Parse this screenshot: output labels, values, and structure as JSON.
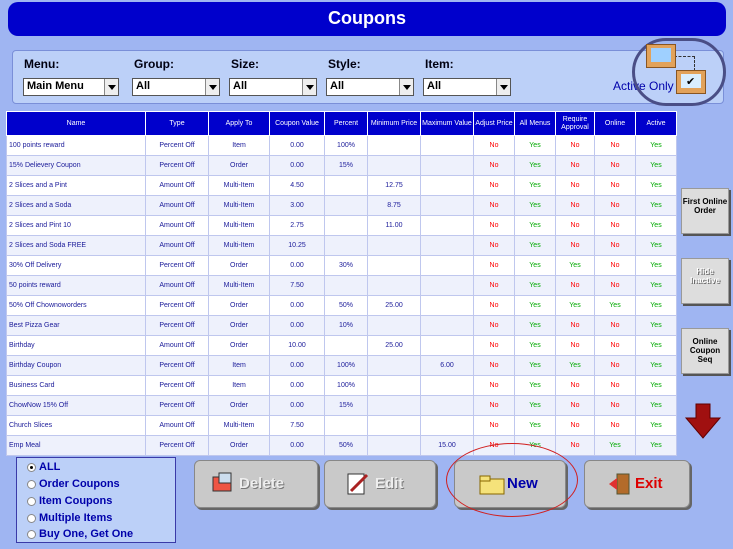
{
  "title": "Coupons",
  "filters": {
    "menu_label": "Menu:",
    "menu_value": "Main Menu",
    "group_label": "Group:",
    "group_value": "All",
    "size_label": "Size:",
    "size_value": "All",
    "style_label": "Style:",
    "style_value": "All",
    "item_label": "Item:",
    "item_value": "All",
    "active_only": "Active Only"
  },
  "columns": [
    "Name",
    "Type",
    "Apply To",
    "Coupon Value",
    "Percent",
    "Minimum Price",
    "Maximum Value",
    "Adjust Price",
    "All Menus",
    "Require Approval",
    "Online",
    "Active"
  ],
  "rows": [
    [
      "100 points reward",
      "Percent Off",
      "Item",
      "0.00",
      "100%",
      "",
      "",
      "No",
      "Yes",
      "No",
      "No",
      "Yes"
    ],
    [
      "15% Delievery Coupon",
      "Percent Off",
      "Order",
      "0.00",
      "15%",
      "",
      "",
      "No",
      "Yes",
      "No",
      "No",
      "Yes"
    ],
    [
      "2 Slices and a Pint",
      "Amount Off",
      "Multi-Item",
      "4.50",
      "",
      "12.75",
      "",
      "No",
      "Yes",
      "No",
      "No",
      "Yes"
    ],
    [
      "2 Slices and a Soda",
      "Amount Off",
      "Multi-Item",
      "3.00",
      "",
      "8.75",
      "",
      "No",
      "Yes",
      "No",
      "No",
      "Yes"
    ],
    [
      "2 Slices and Pint 10",
      "Amount Off",
      "Multi-Item",
      "2.75",
      "",
      "11.00",
      "",
      "No",
      "Yes",
      "No",
      "No",
      "Yes"
    ],
    [
      "2 Slices and Soda FREE",
      "Amount Off",
      "Multi-Item",
      "10.25",
      "",
      "",
      "",
      "No",
      "Yes",
      "No",
      "No",
      "Yes"
    ],
    [
      "30% Off Delivery",
      "Percent Off",
      "Order",
      "0.00",
      "30%",
      "",
      "",
      "No",
      "Yes",
      "Yes",
      "No",
      "Yes"
    ],
    [
      "50 points reward",
      "Amount Off",
      "Multi-Item",
      "7.50",
      "",
      "",
      "",
      "No",
      "Yes",
      "No",
      "No",
      "Yes"
    ],
    [
      "50% Off Chownoworders",
      "Percent Off",
      "Order",
      "0.00",
      "50%",
      "25.00",
      "",
      "No",
      "Yes",
      "Yes",
      "Yes",
      "Yes"
    ],
    [
      "Best Pizza Gear",
      "Percent Off",
      "Order",
      "0.00",
      "10%",
      "",
      "",
      "No",
      "Yes",
      "No",
      "No",
      "Yes"
    ],
    [
      "Birthday",
      "Amount Off",
      "Order",
      "10.00",
      "",
      "25.00",
      "",
      "No",
      "Yes",
      "No",
      "No",
      "Yes"
    ],
    [
      "Birthday Coupon",
      "Percent Off",
      "Item",
      "0.00",
      "100%",
      "",
      "6.00",
      "No",
      "Yes",
      "Yes",
      "No",
      "Yes"
    ],
    [
      "Business Card",
      "Percent Off",
      "Item",
      "0.00",
      "100%",
      "",
      "",
      "No",
      "Yes",
      "No",
      "No",
      "Yes"
    ],
    [
      "ChowNow 15% Off",
      "Percent Off",
      "Order",
      "0.00",
      "15%",
      "",
      "",
      "No",
      "Yes",
      "No",
      "No",
      "Yes"
    ],
    [
      "Church Slices",
      "Amount Off",
      "Multi-Item",
      "7.50",
      "",
      "",
      "",
      "No",
      "Yes",
      "No",
      "No",
      "Yes"
    ],
    [
      "Emp Meal",
      "Percent Off",
      "Order",
      "0.00",
      "50%",
      "",
      "15.00",
      "No",
      "Yes",
      "No",
      "Yes",
      "Yes"
    ]
  ],
  "side_buttons": {
    "first_online_order": "First Online Order",
    "hide_inactive": "Hide Inactive",
    "online_coupon_seq": "Online Coupon Seq"
  },
  "radio_options": [
    "ALL",
    "Order Coupons",
    "Item Coupons",
    "Multiple Items",
    "Buy One, Get One"
  ],
  "buttons": {
    "delete": "Delete",
    "edit": "Edit",
    "new": "New",
    "exit": "Exit"
  }
}
